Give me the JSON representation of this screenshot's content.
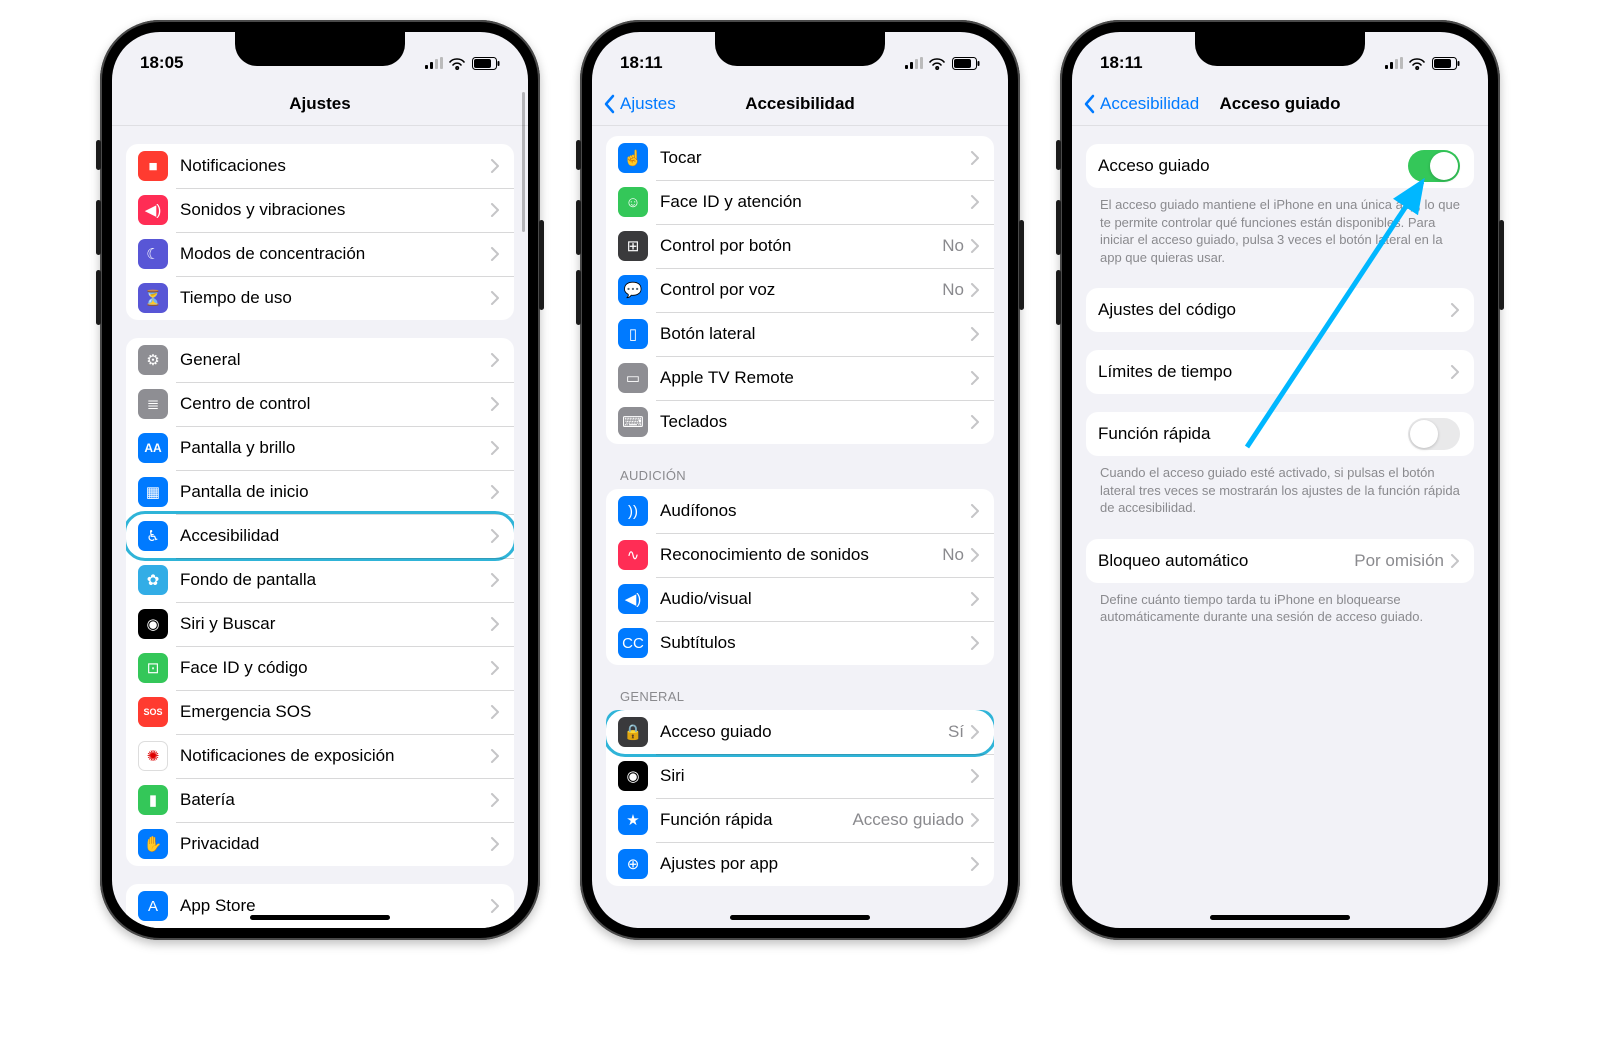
{
  "phone1": {
    "time": "18:05",
    "title": "Ajustes",
    "groups": [
      {
        "items": [
          {
            "icon": "bell-icon",
            "bg": "bg-red",
            "label": "Notificaciones"
          },
          {
            "icon": "speaker-icon",
            "bg": "bg-pink",
            "label": "Sonidos y vibraciones"
          },
          {
            "icon": "moon-icon",
            "bg": "bg-indigo",
            "label": "Modos de concentración"
          },
          {
            "icon": "hourglass-icon",
            "bg": "bg-indigo",
            "label": "Tiempo de uso"
          }
        ]
      },
      {
        "items": [
          {
            "icon": "gear-icon",
            "bg": "bg-gray",
            "label": "General"
          },
          {
            "icon": "switches-icon",
            "bg": "bg-gray",
            "label": "Centro de control"
          },
          {
            "icon": "aa-icon",
            "bg": "bg-blue",
            "label": "Pantalla y brillo"
          },
          {
            "icon": "grid-icon",
            "bg": "bg-gridblue",
            "label": "Pantalla de inicio"
          },
          {
            "icon": "accessibility-icon",
            "bg": "bg-blue",
            "label": "Accesibilidad",
            "highlight": true
          },
          {
            "icon": "flower-icon",
            "bg": "bg-cyan",
            "label": "Fondo de pantalla"
          },
          {
            "icon": "siri-icon",
            "bg": "bg-black",
            "label": "Siri y Buscar"
          },
          {
            "icon": "faceid-icon",
            "bg": "bg-green",
            "label": "Face ID y código"
          },
          {
            "icon": "sos-icon",
            "bg": "bg-red",
            "label": "Emergencia SOS"
          },
          {
            "icon": "virus-icon",
            "bg": "bg-white",
            "label": "Notificaciones de exposición"
          },
          {
            "icon": "battery-icon",
            "bg": "bg-green",
            "label": "Batería"
          },
          {
            "icon": "hand-icon",
            "bg": "bg-blue",
            "label": "Privacidad"
          }
        ]
      },
      {
        "items": [
          {
            "icon": "appstore-icon",
            "bg": "bg-blue",
            "label": "App Store"
          }
        ]
      }
    ]
  },
  "phone2": {
    "time": "18:11",
    "back": "Ajustes",
    "title": "Accesibilidad",
    "sections": [
      {
        "header": null,
        "items": [
          {
            "icon": "touch-icon",
            "bg": "bg-blue",
            "label": "Tocar"
          },
          {
            "icon": "face-icon",
            "bg": "bg-green",
            "label": "Face ID y atención"
          },
          {
            "icon": "grid4-icon",
            "bg": "bg-darkgray",
            "label": "Control por botón",
            "detail": "No"
          },
          {
            "icon": "voice-icon",
            "bg": "bg-blue",
            "label": "Control por voz",
            "detail": "No"
          },
          {
            "icon": "sidebtn-icon",
            "bg": "bg-blue",
            "label": "Botón lateral"
          },
          {
            "icon": "remote-icon",
            "bg": "bg-gray",
            "label": "Apple TV Remote"
          },
          {
            "icon": "keyboard-icon",
            "bg": "bg-gray",
            "label": "Teclados"
          }
        ]
      },
      {
        "header": "AUDICIÓN",
        "items": [
          {
            "icon": "ear-icon",
            "bg": "bg-blue",
            "label": "Audífonos"
          },
          {
            "icon": "soundrec-icon",
            "bg": "bg-pink",
            "label": "Reconocimiento de sonidos",
            "detail": "No"
          },
          {
            "icon": "audiovisual-icon",
            "bg": "bg-blue",
            "label": "Audio/visual"
          },
          {
            "icon": "cc-icon",
            "bg": "bg-blue",
            "label": "Subtítulos"
          }
        ]
      },
      {
        "header": "GENERAL",
        "items": [
          {
            "icon": "lock-icon",
            "bg": "bg-darkgray",
            "label": "Acceso guiado",
            "detail": "Sí",
            "highlight": true
          },
          {
            "icon": "siri-icon",
            "bg": "bg-black",
            "label": "Siri"
          },
          {
            "icon": "shortcut-icon",
            "bg": "bg-blue",
            "label": "Función rápida",
            "detail": "Acceso guiado"
          },
          {
            "icon": "perapp-icon",
            "bg": "bg-blue",
            "label": "Ajustes por app"
          }
        ]
      }
    ]
  },
  "phone3": {
    "time": "18:11",
    "back": "Accesibilidad",
    "title": "Acceso guiado",
    "row_toggle_label": "Acceso guiado",
    "toggle_on": true,
    "footer1": "El acceso guiado mantiene el iPhone en una única app, lo que te permite controlar qué funciones están disponibles. Para iniciar el acceso guiado, pulsa 3 veces el botón lateral en la app que quieras usar.",
    "row_passcode": "Ajustes del código",
    "row_timelimits": "Límites de tiempo",
    "row_shortcut": "Función rápida",
    "shortcut_on": false,
    "footer2": "Cuando el acceso guiado esté activado, si pulsas el botón lateral tres veces se mostrarán los ajustes de la función rápida de accesibilidad.",
    "row_autolock_label": "Bloqueo automático",
    "row_autolock_value": "Por omisión",
    "footer3": "Define cuánto tiempo tarda tu iPhone en bloquearse automáticamente durante una sesión de acceso guiado."
  }
}
